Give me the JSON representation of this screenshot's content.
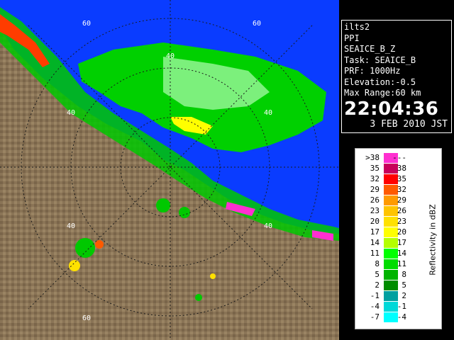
{
  "info": {
    "station": "ilts2",
    "mode": "PPI",
    "product": "SEAICE_B_Z",
    "task": "Task: SEAICE_B",
    "prf": "PRF: 1000Hz",
    "elevation": "Elevation:-0.5",
    "max_range": "Max Range:60 km",
    "time": "22:04:36",
    "date": "3 FEB 2010 JST"
  },
  "legend": {
    "title": "Reflectivity in dBZ",
    "rows": [
      {
        "lo": ">38",
        "hi": "---",
        "color": "#ff2fd0"
      },
      {
        "lo": "35",
        "hi": "38",
        "color": "#c8005a"
      },
      {
        "lo": "32",
        "hi": "35",
        "color": "#ff0000"
      },
      {
        "lo": "29",
        "hi": "32",
        "color": "#ff5a00"
      },
      {
        "lo": "26",
        "hi": "29",
        "color": "#ff9a00"
      },
      {
        "lo": "23",
        "hi": "26",
        "color": "#ffc400"
      },
      {
        "lo": "20",
        "hi": "23",
        "color": "#ffe100"
      },
      {
        "lo": "17",
        "hi": "20",
        "color": "#ffff00"
      },
      {
        "lo": "14",
        "hi": "17",
        "color": "#b4ff00"
      },
      {
        "lo": "11",
        "hi": "14",
        "color": "#00ff00"
      },
      {
        "lo": "8",
        "hi": "11",
        "color": "#00dc00"
      },
      {
        "lo": "5",
        "hi": "8",
        "color": "#00b400"
      },
      {
        "lo": "2",
        "hi": "5",
        "color": "#008c00"
      },
      {
        "lo": "-1",
        "hi": "2",
        "color": "#00a0a0"
      },
      {
        "lo": "-4",
        "hi": "-1",
        "color": "#00d8d8"
      },
      {
        "lo": "-7",
        "hi": "-4",
        "color": "#00ffff"
      }
    ]
  },
  "map": {
    "range_labels": [
      "60",
      "60",
      "40",
      "40",
      "40",
      "40",
      "40",
      "60"
    ],
    "colors": {
      "sea": "#0a3cff",
      "land": "#8a7456",
      "grid": "#1a1a1a"
    }
  }
}
